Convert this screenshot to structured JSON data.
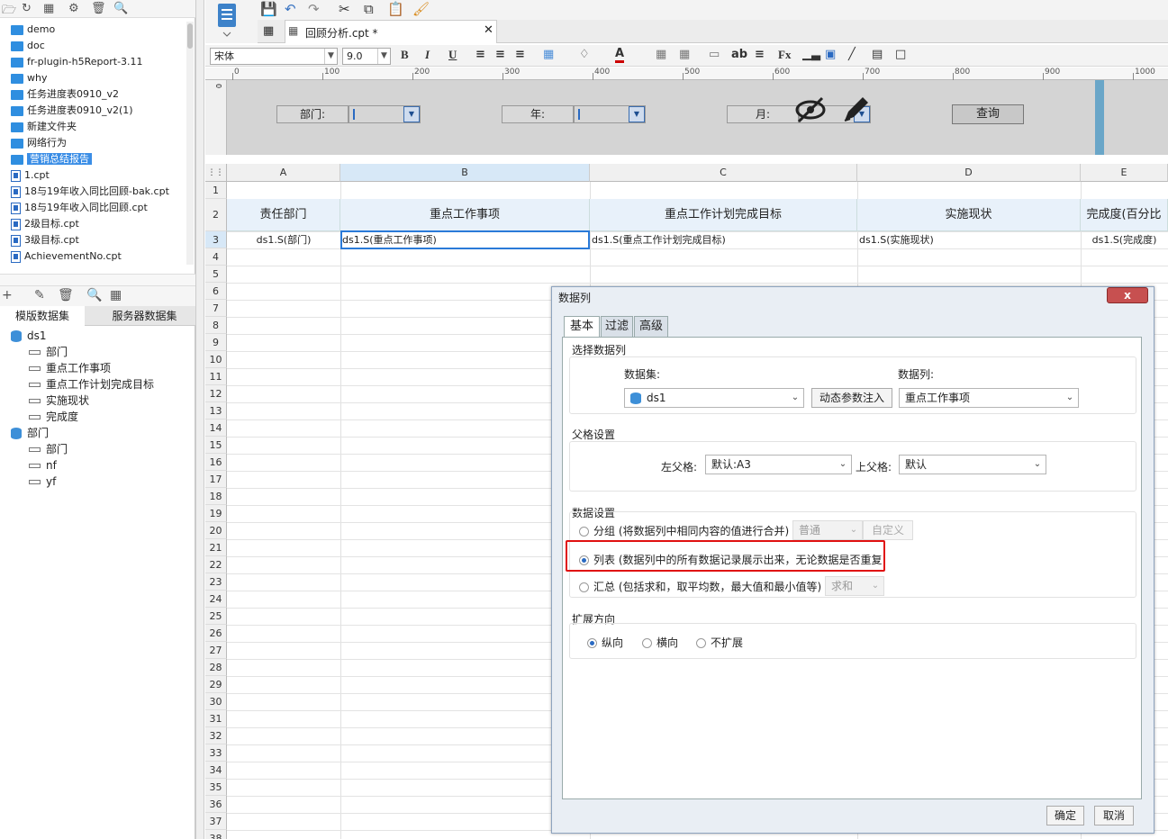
{
  "left_tree": {
    "items": [
      {
        "label": "demo",
        "type": "folder"
      },
      {
        "label": "doc",
        "type": "folder"
      },
      {
        "label": "fr-plugin-h5Report-3.11",
        "type": "folder"
      },
      {
        "label": "why",
        "type": "folder"
      },
      {
        "label": "任务进度表0910_v2",
        "type": "folder"
      },
      {
        "label": "任务进度表0910_v2(1)",
        "type": "folder"
      },
      {
        "label": "新建文件夹",
        "type": "folder"
      },
      {
        "label": "网络行为",
        "type": "folder"
      },
      {
        "label": "营销总结报告",
        "type": "folder",
        "selected": true
      },
      {
        "label": "1.cpt",
        "type": "file"
      },
      {
        "label": "18与19年收入同比回顾-bak.cpt",
        "type": "file"
      },
      {
        "label": "18与19年收入同比回顾.cpt",
        "type": "file"
      },
      {
        "label": "2级目标.cpt",
        "type": "file"
      },
      {
        "label": "3级目标.cpt",
        "type": "file"
      },
      {
        "label": "AchievementNo.cpt",
        "type": "file"
      }
    ]
  },
  "dataset_panel": {
    "tabs": [
      "模版数据集",
      "服务器数据集"
    ],
    "datasets": [
      {
        "name": "ds1",
        "fields": [
          "部门",
          "重点工作事项",
          "重点工作计划完成目标",
          "实施现状",
          "完成度"
        ]
      },
      {
        "name": "部门",
        "fields": [
          "部门",
          "nf",
          "yf"
        ]
      }
    ]
  },
  "editor": {
    "tab_title": "回顾分析.cpt *",
    "font_name": "宋体",
    "font_size": "9.0"
  },
  "ruler": {
    "ticks": [
      "0",
      "100",
      "200",
      "300",
      "400",
      "500",
      "600",
      "700",
      "800",
      "900",
      "1000"
    ]
  },
  "param_pane": {
    "labels": [
      "部门:",
      "年:",
      "月:"
    ],
    "query_button": "查询"
  },
  "sheet": {
    "columns": [
      "A",
      "B",
      "C",
      "D",
      "E"
    ],
    "rows": [
      "1",
      "2",
      "3",
      "4",
      "5",
      "6",
      "7",
      "8",
      "9",
      "10",
      "11",
      "12",
      "13",
      "14",
      "15",
      "16",
      "17",
      "18",
      "19",
      "20",
      "21",
      "22",
      "23",
      "24",
      "25",
      "26",
      "27",
      "28",
      "29",
      "30",
      "31",
      "32",
      "33",
      "34",
      "35",
      "36",
      "37",
      "38"
    ],
    "header_row": [
      "责任部门",
      "重点工作事项",
      "重点工作计划完成目标",
      "实施现状",
      "完成度(百分比"
    ],
    "data_row": [
      "ds1.S(部门)",
      "ds1.S(重点工作事项)",
      "ds1.S(重点工作计划完成目标)",
      "ds1.S(实施现状)",
      "ds1.S(完成度)"
    ]
  },
  "dialog": {
    "title": "数据列",
    "close": "x",
    "tabs": [
      "基本",
      "过滤",
      "高级"
    ],
    "select_section": "选择数据列",
    "dataset_label": "数据集:",
    "column_label": "数据列:",
    "dataset_value": "ds1",
    "dynamic_btn": "动态参数注入",
    "column_value": "重点工作事项",
    "parent_section": "父格设置",
    "left_parent_label": "左父格:",
    "left_parent_value": "默认:A3",
    "top_parent_label": "上父格:",
    "top_parent_value": "默认",
    "data_section": "数据设置",
    "opt_group": "分组 (将数据列中相同内容的值进行合并)",
    "group_mode": "普通",
    "custom": "自定义",
    "opt_list": "列表 (数据列中的所有数据记录展示出来，无论数据是否重复",
    "opt_sum": "汇总 (包括求和，取平均数，最大值和最小值等)",
    "sum_mode": "求和",
    "expand_section": "扩展方向",
    "expand_options": [
      "纵向",
      "横向",
      "不扩展"
    ],
    "ok": "确定",
    "cancel": "取消"
  },
  "colors": {
    "accent": "#2a6ac2",
    "highlight": "#e01010",
    "header_fill": "#e8f1fa"
  }
}
